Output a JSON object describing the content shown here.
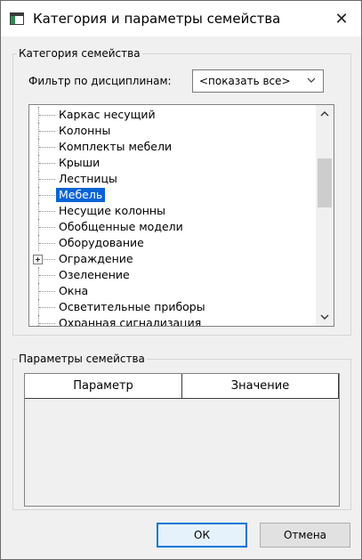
{
  "window": {
    "title": "Категория и параметры семейства",
    "close_label": "✕"
  },
  "category_group": {
    "label": "Категория семейства",
    "filter_label": "Фильтр по дисциплинам:",
    "filter_value": "<показать все>"
  },
  "tree": {
    "items": [
      {
        "label": "Каркас несущий",
        "selected": false,
        "expandable": false
      },
      {
        "label": "Колонны",
        "selected": false,
        "expandable": false
      },
      {
        "label": "Комплекты мебели",
        "selected": false,
        "expandable": false
      },
      {
        "label": "Крыши",
        "selected": false,
        "expandable": false
      },
      {
        "label": "Лестницы",
        "selected": false,
        "expandable": false
      },
      {
        "label": "Мебель",
        "selected": true,
        "expandable": false
      },
      {
        "label": "Несущие колонны",
        "selected": false,
        "expandable": false
      },
      {
        "label": "Обобщенные модели",
        "selected": false,
        "expandable": false
      },
      {
        "label": "Оборудование",
        "selected": false,
        "expandable": false
      },
      {
        "label": "Ограждение",
        "selected": false,
        "expandable": true
      },
      {
        "label": "Озеленение",
        "selected": false,
        "expandable": false
      },
      {
        "label": "Окна",
        "selected": false,
        "expandable": false
      },
      {
        "label": "Осветительные приборы",
        "selected": false,
        "expandable": false
      },
      {
        "label": "Охранная сигнализация",
        "selected": false,
        "expandable": false
      }
    ]
  },
  "params_group": {
    "label": "Параметры семейства",
    "columns": [
      "Параметр",
      "Значение"
    ]
  },
  "buttons": {
    "ok": "ОК",
    "cancel": "Отмена"
  }
}
